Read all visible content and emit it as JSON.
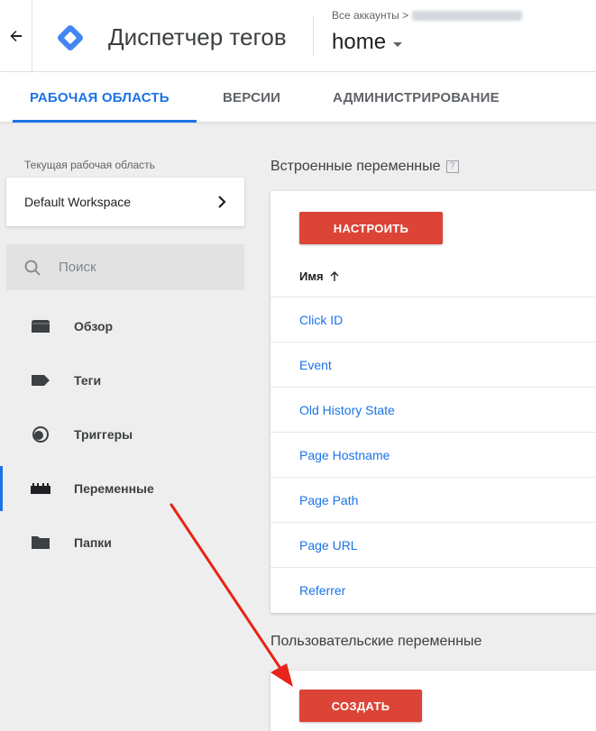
{
  "header": {
    "back_icon": "arrow-back-icon",
    "logo_icon": "gtm-diamond-logo",
    "app_title": "Диспетчер тегов",
    "breadcrumb": "Все аккаунты >",
    "container_name": "home"
  },
  "tabs": [
    {
      "label": "РАБОЧАЯ ОБЛАСТЬ",
      "active": true
    },
    {
      "label": "ВЕРСИИ",
      "active": false
    },
    {
      "label": "АДМИНИСТРИРОВАНИЕ",
      "active": false
    }
  ],
  "sidebar": {
    "workspace_label": "Текущая рабочая область",
    "workspace_name": "Default Workspace",
    "search_placeholder": "Поиск",
    "items": [
      {
        "label": "Обзор",
        "icon": "overview-icon",
        "active": false
      },
      {
        "label": "Теги",
        "icon": "tag-icon",
        "active": false
      },
      {
        "label": "Триггеры",
        "icon": "trigger-icon",
        "active": false
      },
      {
        "label": "Переменные",
        "icon": "variables-icon",
        "active": true
      },
      {
        "label": "Папки",
        "icon": "folder-icon",
        "active": false
      }
    ]
  },
  "builtin": {
    "title": "Встроенные переменные",
    "help": "?",
    "configure_button": "НАСТРОИТЬ",
    "column_header": "Имя",
    "sort_icon": "arrow-up-icon",
    "rows": [
      "Click ID",
      "Event",
      "Old History State",
      "Page Hostname",
      "Page Path",
      "Page URL",
      "Referrer"
    ]
  },
  "user_defined": {
    "title": "Пользовательские переменные",
    "create_button": "СОЗДАТЬ"
  },
  "colors": {
    "accent": "#1a73e8",
    "button": "#db4437",
    "annotation_arrow": "#e8231a"
  }
}
